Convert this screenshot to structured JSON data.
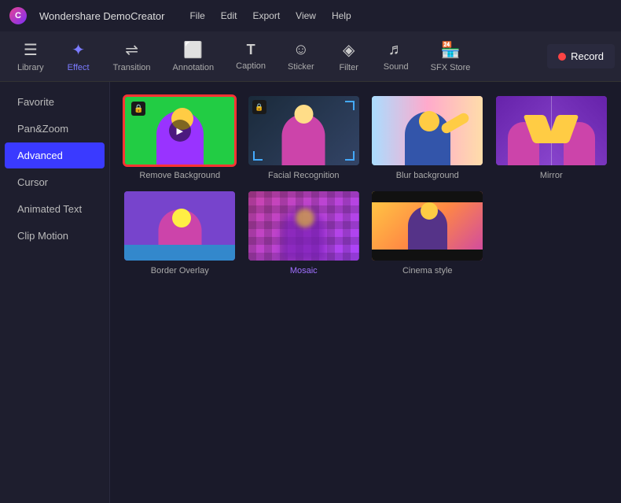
{
  "app": {
    "logo": "C",
    "title": "Wondershare DemoCreator"
  },
  "menu": {
    "items": [
      "File",
      "Edit",
      "Export",
      "View",
      "Help"
    ]
  },
  "toolbar": {
    "items": [
      {
        "id": "library",
        "label": "Library",
        "icon": "☰",
        "active": false
      },
      {
        "id": "effect",
        "label": "Effect",
        "icon": "✦",
        "active": true
      },
      {
        "id": "transition",
        "label": "Transition",
        "icon": "⇌",
        "active": false
      },
      {
        "id": "annotation",
        "label": "Annotation",
        "icon": "⬜",
        "active": false
      },
      {
        "id": "caption",
        "label": "Caption",
        "icon": "T",
        "active": false
      },
      {
        "id": "sticker",
        "label": "Sticker",
        "icon": "☺",
        "active": false
      },
      {
        "id": "filter",
        "label": "Filter",
        "icon": "⟡",
        "active": false
      },
      {
        "id": "sound",
        "label": "Sound",
        "icon": "♬",
        "active": false
      },
      {
        "id": "sfxstore",
        "label": "SFX Store",
        "icon": "🏪",
        "active": false
      }
    ],
    "record_label": "Record"
  },
  "sidebar": {
    "items": [
      {
        "id": "favorite",
        "label": "Favorite",
        "active": false
      },
      {
        "id": "panzoom",
        "label": "Pan&Zoom",
        "active": false
      },
      {
        "id": "advanced",
        "label": "Advanced",
        "active": true
      },
      {
        "id": "cursor",
        "label": "Cursor",
        "active": false
      },
      {
        "id": "animatedtext",
        "label": "Animated Text",
        "active": false
      },
      {
        "id": "clipmotion",
        "label": "Clip Motion",
        "active": false
      }
    ]
  },
  "effects": {
    "items": [
      {
        "id": "remove-bg",
        "label": "Remove Background",
        "type": "remove-bg",
        "selected": true,
        "locked": true,
        "label_color": "normal"
      },
      {
        "id": "facial",
        "label": "Facial Recognition",
        "type": "facial",
        "selected": false,
        "locked": true,
        "label_color": "normal"
      },
      {
        "id": "blur-bg",
        "label": "Blur background",
        "type": "blur",
        "selected": false,
        "locked": false,
        "label_color": "normal"
      },
      {
        "id": "mirror",
        "label": "Mirror",
        "type": "mirror",
        "selected": false,
        "locked": false,
        "label_color": "normal"
      },
      {
        "id": "border",
        "label": "Border Overlay",
        "type": "border",
        "selected": false,
        "locked": false,
        "label_color": "normal"
      },
      {
        "id": "mosaic",
        "label": "Mosaic",
        "type": "mosaic",
        "selected": false,
        "locked": false,
        "label_color": "purple"
      },
      {
        "id": "cinema",
        "label": "Cinema style",
        "type": "cinema",
        "selected": false,
        "locked": false,
        "label_color": "normal"
      }
    ]
  }
}
